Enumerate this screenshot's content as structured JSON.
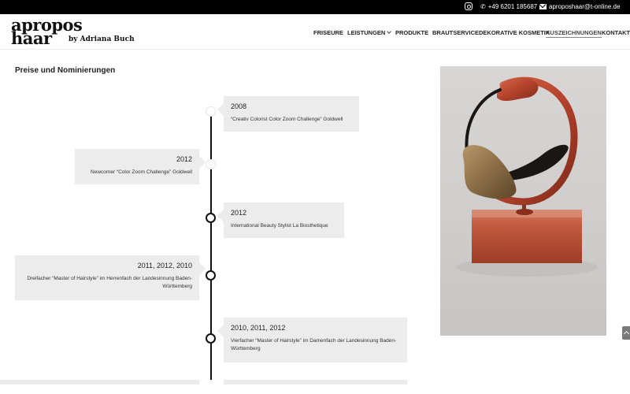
{
  "topbar": {
    "phone": "+49 6201 185687",
    "email": "aproposhaar@t-online.de",
    "icons": [
      "instagram-icon",
      "phone-icon",
      "mail-icon"
    ]
  },
  "logo": {
    "line1": "apropos",
    "line2": "haar",
    "line3": "by Adriana Buch"
  },
  "nav": {
    "items": [
      {
        "label": "FRISEURE"
      },
      {
        "label": "LEISTUNGEN"
      },
      {
        "label": "PRODUKTE"
      },
      {
        "label": "BRAUTSERVICE"
      },
      {
        "label": "DEKORATIVE KOSMETIK"
      },
      {
        "label": "AUSZEICHNUNGEN"
      },
      {
        "label": "KONTAKT"
      }
    ],
    "active": "AUSZEICHNUNGEN"
  },
  "main": {
    "section_title": "Preise und Nominierungen",
    "timeline": [
      {
        "year": "2008",
        "desc": "“Creativ Colorist Color Zoom Challenge” Goldwell",
        "side": "right"
      },
      {
        "year": "2012",
        "desc": "Newcomer “Color Zoom Challenge” Goldwell",
        "side": "left"
      },
      {
        "year": "2012",
        "desc": "International Beauty Stylist La Biosthetique",
        "side": "right"
      },
      {
        "year": "2011, 2012, 2010",
        "desc": "Dreifacher “Master of Hairstyle” im Herrenfach der Landesinnung Baden-Württemberg",
        "side": "left"
      },
      {
        "year": "2010, 2011, 2012",
        "desc": "Vierfacher “Master of Hairstyle” im Damenfach der Landesinnung Baden-Württemberg",
        "side": "right"
      }
    ]
  },
  "colors": {
    "topbar": "#000000",
    "card": "#ececec",
    "timeline_line": "#111111",
    "trophy_red": "#b5432c",
    "trophy_black": "#1a1614",
    "trophy_gold": "#8a6d45"
  }
}
